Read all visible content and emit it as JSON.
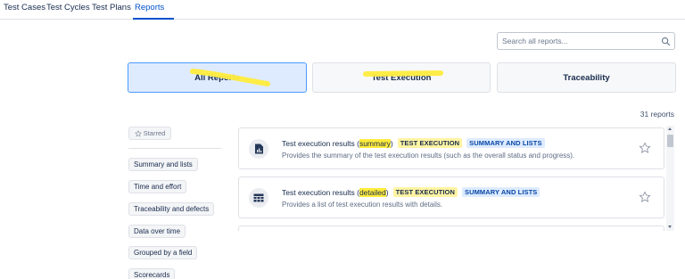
{
  "colors": {
    "accent": "#0052cc",
    "active_card_bg": "#deebff",
    "highlighter": "#ffec3d"
  },
  "tabs": [
    {
      "label": "Test Cases",
      "active": false
    },
    {
      "label": "Test Cycles",
      "active": false
    },
    {
      "label": "Test Plans",
      "active": false
    },
    {
      "label": "Reports",
      "active": true
    }
  ],
  "search": {
    "placeholder": "Search all reports...",
    "icon": "search-icon"
  },
  "categories": [
    {
      "label": "All Reports",
      "active": true
    },
    {
      "label": "Test Execution",
      "active": false
    },
    {
      "label": "Traceability",
      "active": false
    }
  ],
  "report_count": "31 reports",
  "sidebar": {
    "starred_label": "Starred",
    "starred_icon": "star-outline-icon",
    "items": [
      {
        "label": "Summary and lists"
      },
      {
        "label": "Time and effort"
      },
      {
        "label": "Traceability and defects"
      },
      {
        "label": "Data over time"
      },
      {
        "label": "Grouped by a field"
      },
      {
        "label": "Scorecards"
      }
    ]
  },
  "reports": [
    {
      "title_prefix": "Test execution results (",
      "title_highlight": "summary",
      "title_suffix": ")",
      "type_badge": "TEST EXECUTION",
      "category_badge": "SUMMARY AND LISTS",
      "description": "Provides the summary of the test execution results (such as the overall status and progress).",
      "icon": "chart-report-icon",
      "starred": false
    },
    {
      "title_prefix": "Test execution results (",
      "title_highlight": "detailed",
      "title_suffix": ")",
      "type_badge": "TEST EXECUTION",
      "category_badge": "SUMMARY AND LISTS",
      "description": "Provides a list of test execution results with details.",
      "icon": "table-report-icon",
      "starred": false
    }
  ]
}
